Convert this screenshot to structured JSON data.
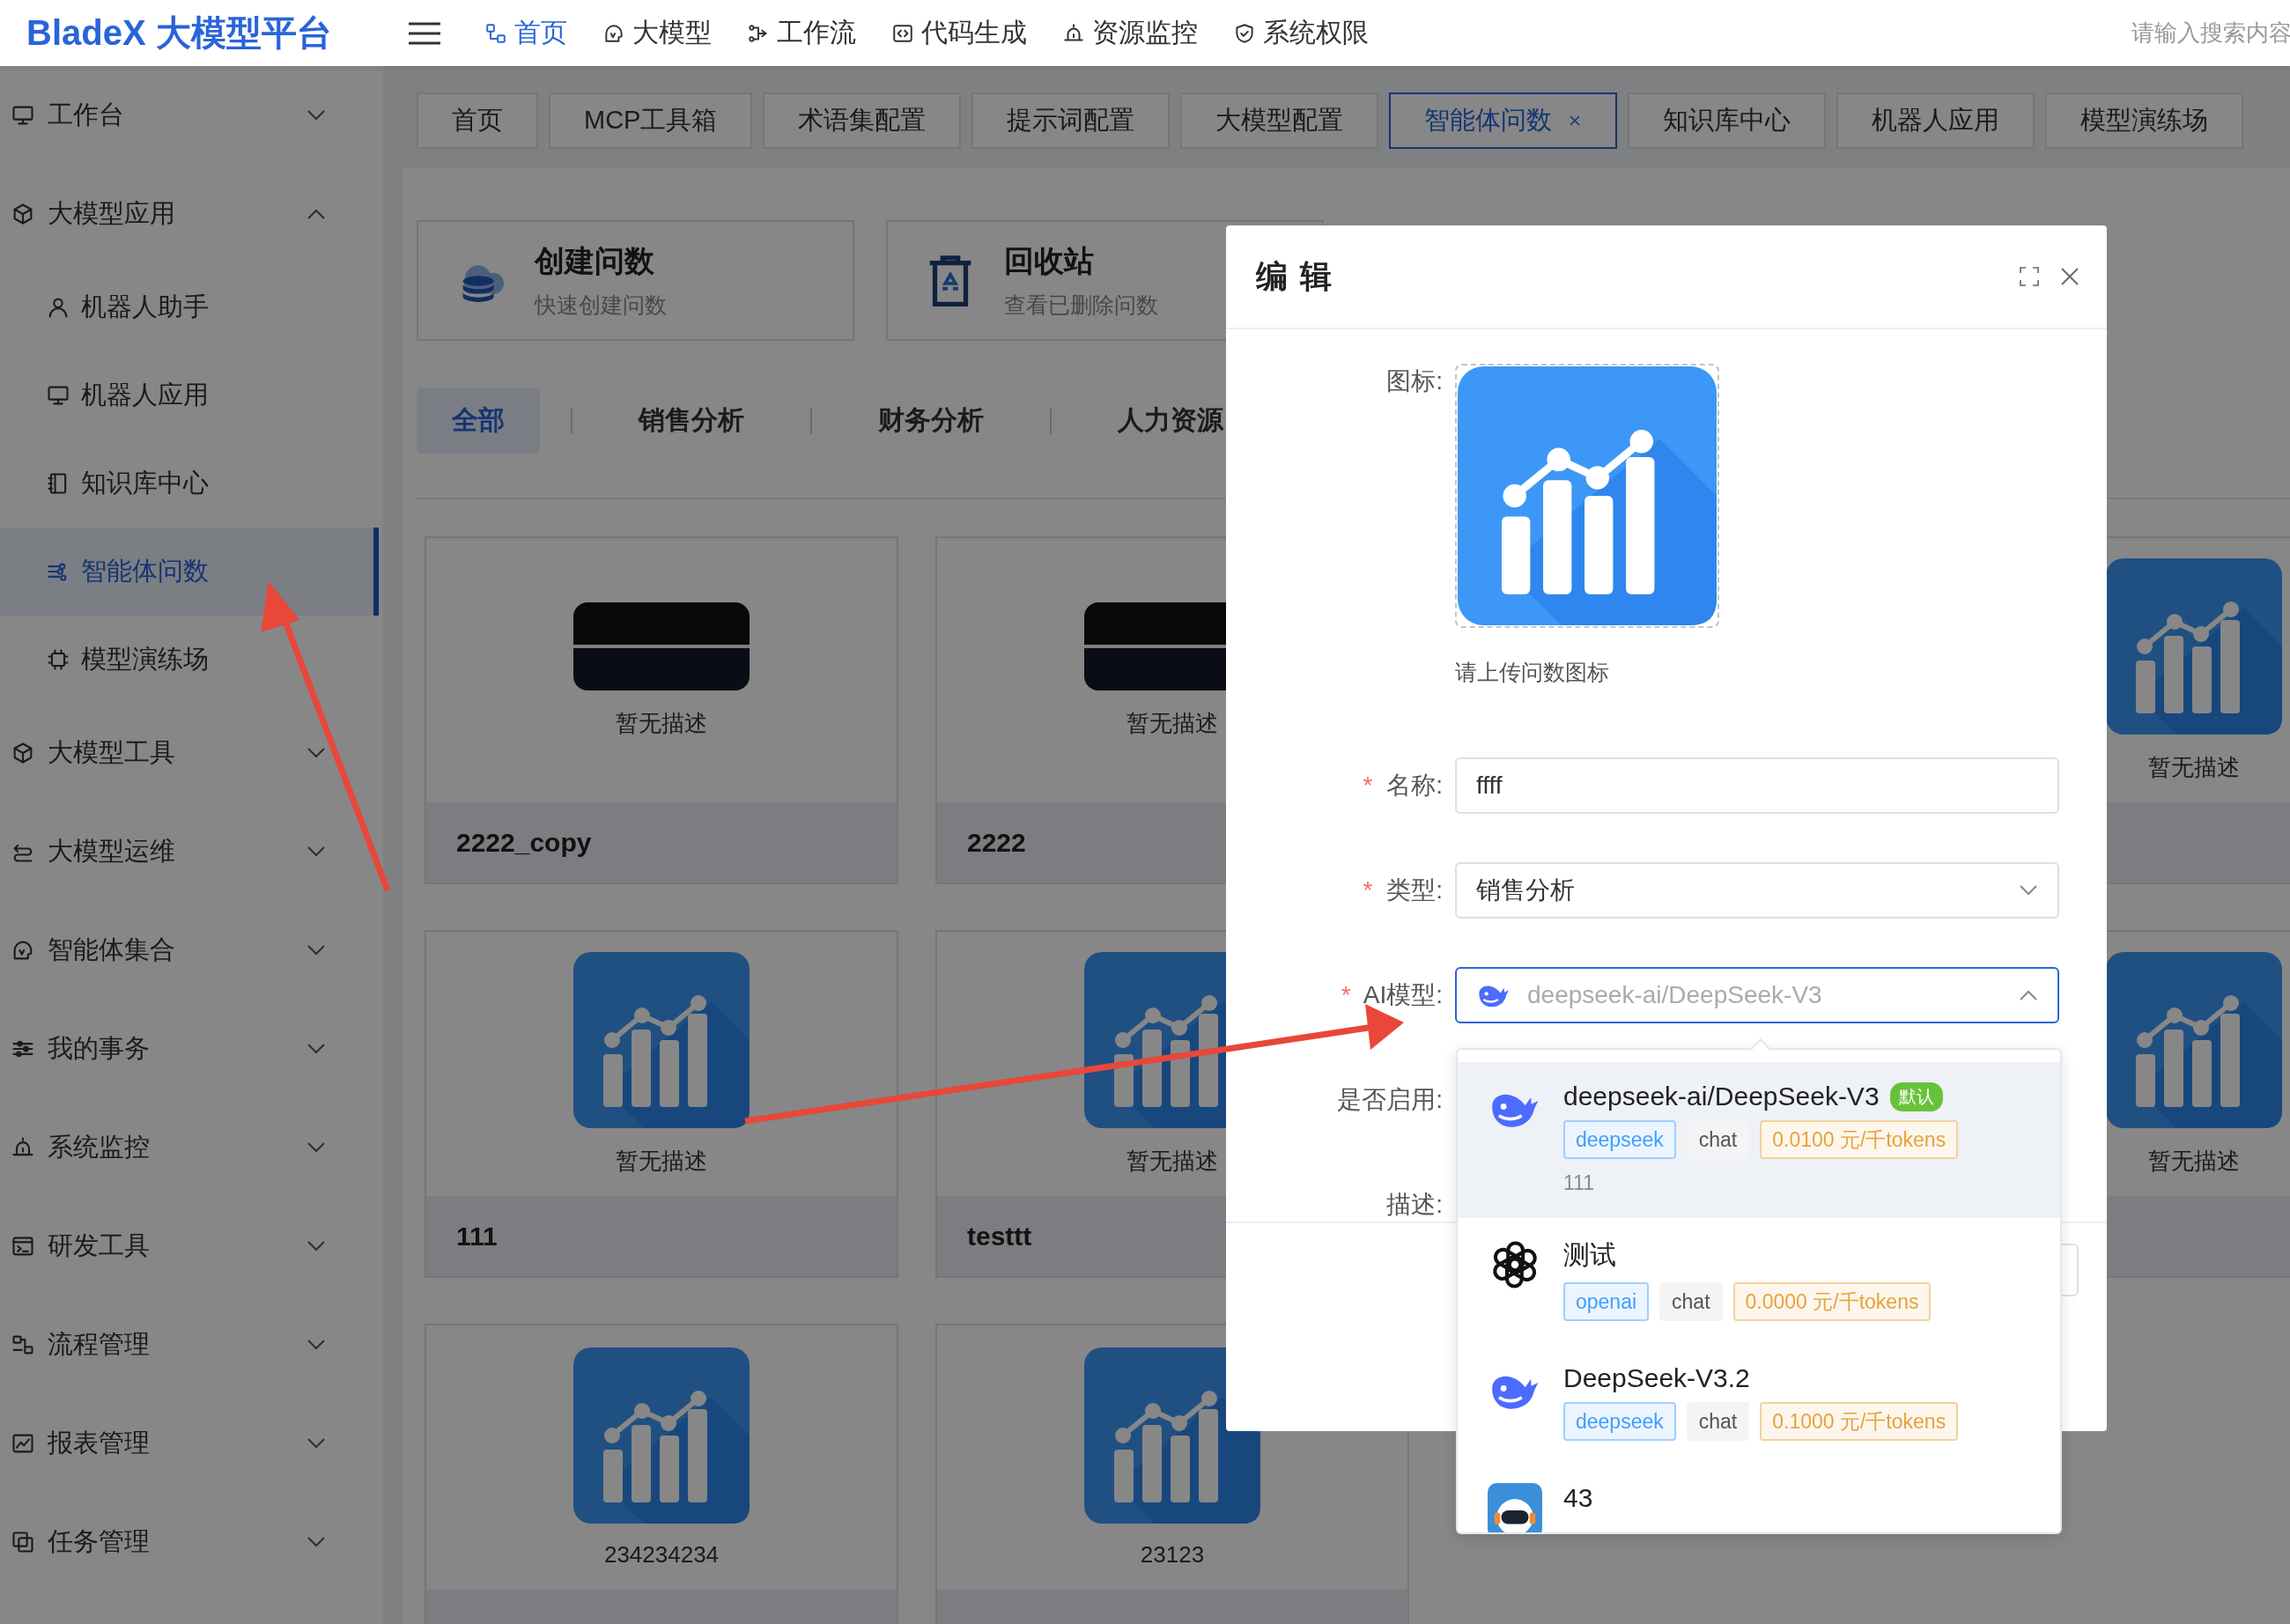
{
  "topbar": {
    "logo": "BladeX 大模型平台",
    "nav": [
      {
        "label": "首页",
        "selected": true
      },
      {
        "label": "大模型",
        "selected": false
      },
      {
        "label": "工作流",
        "selected": false
      },
      {
        "label": "代码生成",
        "selected": false
      },
      {
        "label": "资源监控",
        "selected": false
      },
      {
        "label": "系统权限",
        "selected": false
      }
    ],
    "search": {
      "placeholder": "请输入搜索内容"
    }
  },
  "tabs": [
    {
      "label": "首页",
      "selected": false,
      "closable": false
    },
    {
      "label": "MCP工具箱",
      "selected": false,
      "closable": false
    },
    {
      "label": "术语集配置",
      "selected": false,
      "closable": false
    },
    {
      "label": "提示词配置",
      "selected": false,
      "closable": false
    },
    {
      "label": "大模型配置",
      "selected": false,
      "closable": false
    },
    {
      "label": "智能体问数",
      "selected": true,
      "closable": true
    },
    {
      "label": "知识库中心",
      "selected": false,
      "closable": false
    },
    {
      "label": "机器人应用",
      "selected": false,
      "closable": false
    },
    {
      "label": "模型演练场",
      "selected": false,
      "closable": false
    }
  ],
  "sidebar": {
    "items": [
      {
        "label": "工作台",
        "expanded": false
      },
      {
        "label": "大模型应用",
        "expanded": true,
        "children": [
          {
            "label": "机器人助手",
            "selected": false
          },
          {
            "label": "机器人应用",
            "selected": false
          },
          {
            "label": "知识库中心",
            "selected": false
          },
          {
            "label": "智能体问数",
            "selected": true
          },
          {
            "label": "模型演练场",
            "selected": false
          }
        ]
      },
      {
        "label": "大模型工具",
        "expanded": false
      },
      {
        "label": "大模型运维",
        "expanded": false
      },
      {
        "label": "智能体集合",
        "expanded": false
      },
      {
        "label": "我的事务",
        "expanded": false
      },
      {
        "label": "系统监控",
        "expanded": false
      },
      {
        "label": "研发工具",
        "expanded": false
      },
      {
        "label": "流程管理",
        "expanded": false
      },
      {
        "label": "报表管理",
        "expanded": false
      },
      {
        "label": "任务管理",
        "expanded": false
      }
    ]
  },
  "main": {
    "actions": [
      {
        "title": "创建问数",
        "subtitle": "快速创建问数"
      },
      {
        "title": "回收站",
        "subtitle": "查看已删除问数"
      }
    ],
    "categories": [
      {
        "label": "全部",
        "selected": true
      },
      {
        "label": "销售分析",
        "selected": false
      },
      {
        "label": "财务分析",
        "selected": false
      },
      {
        "label": "人力资源",
        "selected": false
      }
    ],
    "card_rows": [
      {
        "cards": [
          {
            "kind": "screenshot",
            "description": "暂无描述",
            "name": "2222_copy"
          },
          {
            "kind": "screenshot",
            "description": "暂无描述",
            "name": "2222"
          },
          {
            "kind": "chart",
            "description": "暂无描述"
          }
        ]
      },
      {
        "cards": [
          {
            "kind": "chart",
            "description": "暂无描述",
            "name": "111"
          },
          {
            "kind": "chart",
            "description": "暂无描述",
            "name": "testtt"
          },
          {
            "kind": "chart",
            "description": "暂无描述"
          }
        ]
      },
      {
        "cards": [
          {
            "kind": "chart",
            "description": "234234234"
          },
          {
            "kind": "chart",
            "description": "23123"
          }
        ]
      }
    ]
  },
  "modal": {
    "title": "编 辑",
    "fields": [
      {
        "kind": "upload",
        "label": "图标:",
        "hint": "请上传问数图标"
      },
      {
        "kind": "input",
        "label": "名称:",
        "required_mark": "*",
        "value": "ffff"
      },
      {
        "kind": "select",
        "label": "类型:",
        "required_mark": "*",
        "value": "销售分析",
        "open": false
      },
      {
        "kind": "model-select",
        "label": "AI模型:",
        "required_mark": "*",
        "placeholder": "deepseek-ai/DeepSeek-V3",
        "open": true
      },
      {
        "kind": "switch",
        "label": "是否启用:"
      },
      {
        "kind": "textarea",
        "label": "描述:"
      }
    ],
    "options": [
      {
        "kind": "deepseek",
        "name": "deepseek-ai/DeepSeek-V3",
        "badge": "默认",
        "provider": "deepseek",
        "type": "chat",
        "price": "0.0100 元/千tokens",
        "description": "111",
        "selected": true
      },
      {
        "kind": "openai",
        "name": "测试",
        "provider": "openai",
        "type": "chat",
        "price": "0.0000 元/千tokens",
        "selected": false
      },
      {
        "kind": "deepseek",
        "name": "DeepSeek-V3.2",
        "provider": "deepseek",
        "type": "chat",
        "price": "0.1000 元/千tokens",
        "selected": false
      },
      {
        "kind": "robot",
        "name": "43",
        "selected": false
      }
    ]
  }
}
